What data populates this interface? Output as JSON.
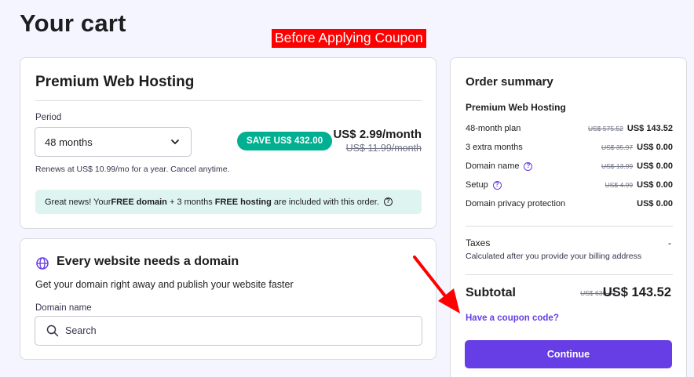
{
  "page": {
    "title": "Your cart",
    "annotation": "Before Applying Coupon"
  },
  "hosting": {
    "title": "Premium Web Hosting",
    "period_label": "Period",
    "period_value": "48 months",
    "save_badge": "SAVE US$ 432.00",
    "price_now": "US$ 2.99/month",
    "price_old": "US$ 11.99/month",
    "renews": "Renews at US$ 10.99/mo for a year. Cancel anytime.",
    "news": {
      "prefix": "Great news! Your ",
      "bold1": "FREE domain",
      "middle": " + 3 months ",
      "bold2": "FREE hosting",
      "suffix": " are included with this order."
    }
  },
  "domain": {
    "title": "Every website needs a domain",
    "subtitle": "Get your domain right away and publish your website faster",
    "field_label": "Domain name",
    "search_placeholder": "Search"
  },
  "summary": {
    "title": "Order summary",
    "product": "Premium Web Hosting",
    "rows": [
      {
        "label": "48-month plan",
        "old": "US$ 575.52",
        "new": "US$ 143.52",
        "help": false
      },
      {
        "label": "3 extra months",
        "old": "US$ 35.97",
        "new": "US$ 0.00",
        "help": false
      },
      {
        "label": "Domain name",
        "old": "US$ 13.99",
        "new": "US$ 0.00",
        "help": true
      },
      {
        "label": "Setup",
        "old": "US$ 4.99",
        "new": "US$ 0.00",
        "help": true
      },
      {
        "label": "Domain privacy protection",
        "old": "",
        "new": "US$ 0.00",
        "help": false
      }
    ],
    "taxes_label": "Taxes",
    "taxes_value": "-",
    "taxes_note": "Calculated after you provide your billing address",
    "subtotal_label": "Subtotal",
    "subtotal_old": "US$ 630.47",
    "subtotal_new": "US$ 143.52",
    "coupon_link": "Have a coupon code?",
    "continue_label": "Continue"
  },
  "colors": {
    "accent": "#673de6",
    "save_badge": "#00b090",
    "news_bg": "#def4f0",
    "annotation": "#ff0000"
  }
}
